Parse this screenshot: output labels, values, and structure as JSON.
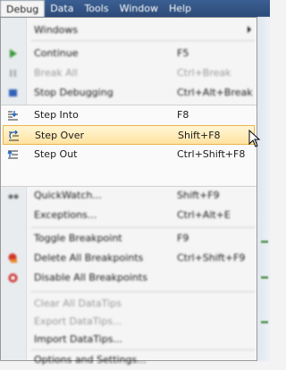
{
  "menubar": {
    "items": [
      "Debug",
      "Data",
      "Tools",
      "Window",
      "Help"
    ],
    "active": "Debug"
  },
  "debug_menu": {
    "windows": {
      "label": "Windows"
    },
    "continue": {
      "label": "Continue",
      "shortcut": "F5",
      "icon": "play-icon"
    },
    "break_all": {
      "label": "Break All",
      "shortcut": "Ctrl+Break",
      "icon": "pause-icon"
    },
    "stop_debugging": {
      "label": "Stop Debugging",
      "shortcut": "Ctrl+Alt+Break",
      "icon": "stop-icon"
    },
    "step_into": {
      "label": "Step Into",
      "shortcut": "F8",
      "icon": "step-into-icon"
    },
    "step_over": {
      "label": "Step Over",
      "shortcut": "Shift+F8",
      "icon": "step-over-icon"
    },
    "step_out": {
      "label": "Step Out",
      "shortcut": "Ctrl+Shift+F8",
      "icon": "step-out-icon"
    },
    "quickwatch": {
      "label": "QuickWatch...",
      "shortcut": "Shift+F9",
      "icon": "glasses-icon"
    },
    "exceptions": {
      "label": "Exceptions...",
      "shortcut": "Ctrl+Alt+E"
    },
    "toggle_breakpoint": {
      "label": "Toggle Breakpoint",
      "shortcut": "F9"
    },
    "delete_all_breakpoints": {
      "label": "Delete All Breakpoints",
      "shortcut": "Ctrl+Shift+F9",
      "icon": "delete-breakpoints-icon"
    },
    "disable_all_breakpoints": {
      "label": "Disable All Breakpoints",
      "icon": "disable-breakpoints-icon"
    },
    "clear_all_datatips": {
      "label": "Clear All DataTips"
    },
    "export_datatips": {
      "label": "Export DataTips..."
    },
    "import_datatips": {
      "label": "Import DataTips..."
    },
    "options_settings": {
      "label": "Options and Settings..."
    }
  },
  "colors": {
    "menubar": "#2c4a78",
    "highlight_top": "#fff6d6",
    "highlight_bottom": "#ffe3a1",
    "highlight_border": "#e8b64a"
  }
}
